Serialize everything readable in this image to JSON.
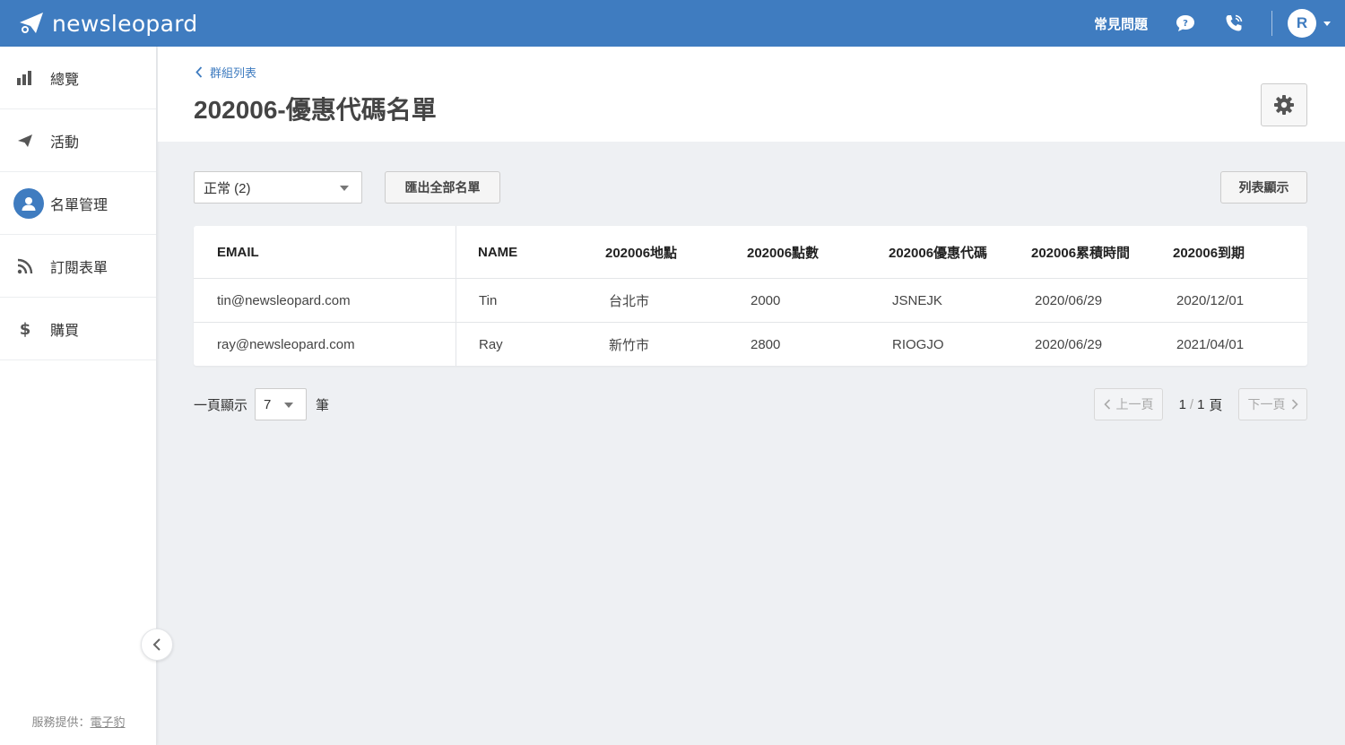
{
  "app": {
    "brand": "newsleopard"
  },
  "topbar": {
    "faq_label": "常見問題",
    "avatar_initial": "R"
  },
  "sidebar": {
    "items": [
      {
        "label": "總覽",
        "icon": "bar-chart-icon"
      },
      {
        "label": "活動",
        "icon": "paper-plane-icon"
      },
      {
        "label": "名單管理",
        "icon": "user-icon"
      },
      {
        "label": "訂閱表單",
        "icon": "rss-icon"
      },
      {
        "label": "購買",
        "icon": "dollar-icon"
      }
    ],
    "footer_prefix": "服務提供：",
    "footer_link": "電子豹"
  },
  "header": {
    "breadcrumb": "群組列表",
    "title": "202006-優惠代碼名單"
  },
  "toolbar": {
    "status_select": "正常 (2)",
    "export_label": "匯出全部名單",
    "view_label": "列表顯示"
  },
  "table": {
    "columns": [
      "EMAIL",
      "NAME",
      "202006地點",
      "202006點數",
      "202006優惠代碼",
      "202006累積時間",
      "202006到期"
    ],
    "rows": [
      [
        "tin@newsleopard.com",
        "Tin",
        "台北市",
        "2000",
        "JSNEJK",
        "2020/06/29",
        "2020/12/01"
      ],
      [
        "ray@newsleopard.com",
        "Ray",
        "新竹市",
        "2800",
        "RIOGJO",
        "2020/06/29",
        "2021/04/01"
      ]
    ]
  },
  "pagination": {
    "per_page_prefix": "一頁顯示",
    "per_page_value": "7",
    "per_page_suffix": "筆",
    "prev_label": "上一頁",
    "next_label": "下一頁",
    "current_page": "1",
    "page_separator": "/",
    "total_pages": "1",
    "page_unit": "頁"
  },
  "colors": {
    "brand": "#3f7cc0",
    "background": "#eef0f3"
  }
}
